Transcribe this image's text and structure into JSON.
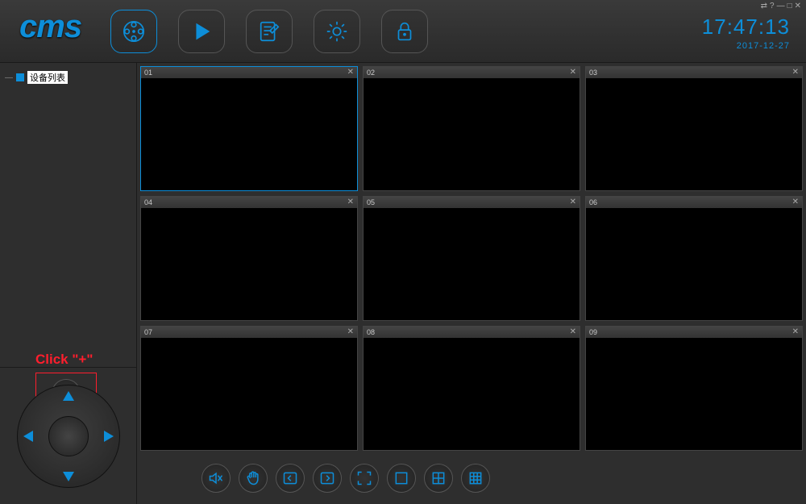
{
  "logo": "cms",
  "clock": {
    "time": "17:47:13",
    "date": "2017-12-27"
  },
  "tree": {
    "root_label": "设备列表"
  },
  "hint": {
    "text": "Click \"+\""
  },
  "grid": {
    "cells": [
      "01",
      "02",
      "03",
      "04",
      "05",
      "06",
      "07",
      "08",
      "09"
    ],
    "active_index": 0
  },
  "nav": {
    "items": [
      "live-icon",
      "playback-icon",
      "log-icon",
      "settings-icon",
      "lock-icon"
    ],
    "active_index": 0
  },
  "toolbar_icons": [
    "mute-icon",
    "hand-icon",
    "prev-page-icon",
    "next-page-icon",
    "fullscreen-icon",
    "layout-1-icon",
    "layout-4-icon",
    "layout-9-icon"
  ],
  "window_controls": [
    "switch",
    "help",
    "minimize",
    "maximize",
    "close"
  ]
}
